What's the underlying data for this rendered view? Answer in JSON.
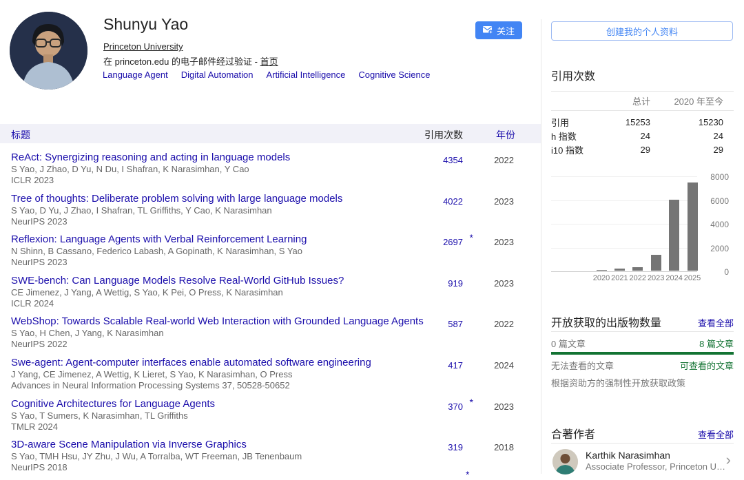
{
  "colors": {
    "accent": "#4285f4",
    "link": "#1a0dab",
    "green": "#137333",
    "bar": "#757575",
    "header_bg": "#f1f1f8"
  },
  "profile": {
    "name": "Shunyu Yao",
    "affiliation": "Princeton University",
    "verified_text": "在 princeton.edu 的电子邮件经过验证 - ",
    "homepage_label": "首页",
    "follow_label": "关注",
    "interests": [
      "Language Agent",
      "Digital Automation",
      "Artificial Intelligence",
      "Cognitive Science"
    ]
  },
  "table": {
    "headers": {
      "title": "标题",
      "cited_by": "引用次数",
      "year": "年份"
    },
    "partial_star": "*",
    "rows": [
      {
        "title": "ReAct: Synergizing reasoning and acting in language models",
        "authors": "S Yao, J Zhao, D Yu, N Du, I Shafran, K Narasimhan, Y Cao",
        "venue": "ICLR 2023",
        "cited": "4354",
        "star": false,
        "year": "2022"
      },
      {
        "title": "Tree of thoughts: Deliberate problem solving with large language models",
        "authors": "S Yao, D Yu, J Zhao, I Shafran, TL Griffiths, Y Cao, K Narasimhan",
        "venue": "NeurIPS 2023",
        "cited": "4022",
        "star": false,
        "year": "2023"
      },
      {
        "title": "Reflexion: Language Agents with Verbal Reinforcement Learning",
        "authors": "N Shinn, B Cassano, Federico Labash, A Gopinath, K Narasimhan, S Yao",
        "venue": "NeurIPS 2023",
        "cited": "2697",
        "star": true,
        "year": "2023"
      },
      {
        "title": "SWE-bench: Can Language Models Resolve Real-World GitHub Issues?",
        "authors": "CE Jimenez, J Yang, A Wettig, S Yao, K Pei, O Press, K Narasimhan",
        "venue": "ICLR 2024",
        "cited": "919",
        "star": false,
        "year": "2023"
      },
      {
        "title": "WebShop: Towards Scalable Real-world Web Interaction with Grounded Language Agents",
        "authors": "S Yao, H Chen, J Yang, K Narasimhan",
        "venue": "NeurIPS 2022",
        "cited": "587",
        "star": false,
        "year": "2022"
      },
      {
        "title": "Swe-agent: Agent-computer interfaces enable automated software engineering",
        "authors": "J Yang, CE Jimenez, A Wettig, K Lieret, S Yao, K Narasimhan, O Press",
        "venue": "Advances in Neural Information Processing Systems 37, 50528-50652",
        "cited": "417",
        "star": false,
        "year": "2024"
      },
      {
        "title": "Cognitive Architectures for Language Agents",
        "authors": "S Yao, T Sumers, K Narasimhan, TL Griffiths",
        "venue": "TMLR 2024",
        "cited": "370",
        "star": true,
        "year": "2023"
      },
      {
        "title": "3D-aware Scene Manipulation via Inverse Graphics",
        "authors": "S Yao, TMH Hsu, JY Zhu, J Wu, A Torralba, WT Freeman, JB Tenenbaum",
        "venue": "NeurIPS 2018",
        "cited": "319",
        "star": false,
        "year": "2018"
      }
    ]
  },
  "sidebar": {
    "create_profile_label": "创建我的个人资料",
    "cited_section": {
      "title": "引用次数",
      "col_all": "总计",
      "col_since": "2020 年至今",
      "rows": [
        {
          "label": "引用",
          "all": "15253",
          "since": "15230"
        },
        {
          "label": "h 指数",
          "all": "24",
          "since": "24"
        },
        {
          "label": "i10 指数",
          "all": "29",
          "since": "29"
        }
      ]
    },
    "open_access": {
      "title": "开放获取的出版物数量",
      "view_all": "查看全部",
      "closed_count": "0 篇文章",
      "open_count": "8 篇文章",
      "closed_label": "无法查看的文章",
      "open_label": "可查看的文章",
      "note": "根据资助方的强制性开放获取政策"
    },
    "coauthors": {
      "title": "合著作者",
      "view_all": "查看全部",
      "items": [
        {
          "name": "Karthik Narasimhan",
          "affiliation": "Associate Professor, Princeton U…"
        }
      ]
    }
  },
  "chart_data": {
    "type": "bar",
    "title": "引用次数",
    "categories": [
      "2020",
      "2021",
      "2022",
      "2023",
      "2024",
      "2025"
    ],
    "values": [
      15,
      150,
      300,
      1350,
      6000,
      7415
    ],
    "xlabel": "",
    "ylabel": "",
    "ylim": [
      0,
      8000
    ],
    "yticks": [
      0,
      2000,
      4000,
      6000,
      8000
    ],
    "grid": true,
    "legend": "none",
    "bar_color": "#757575"
  }
}
